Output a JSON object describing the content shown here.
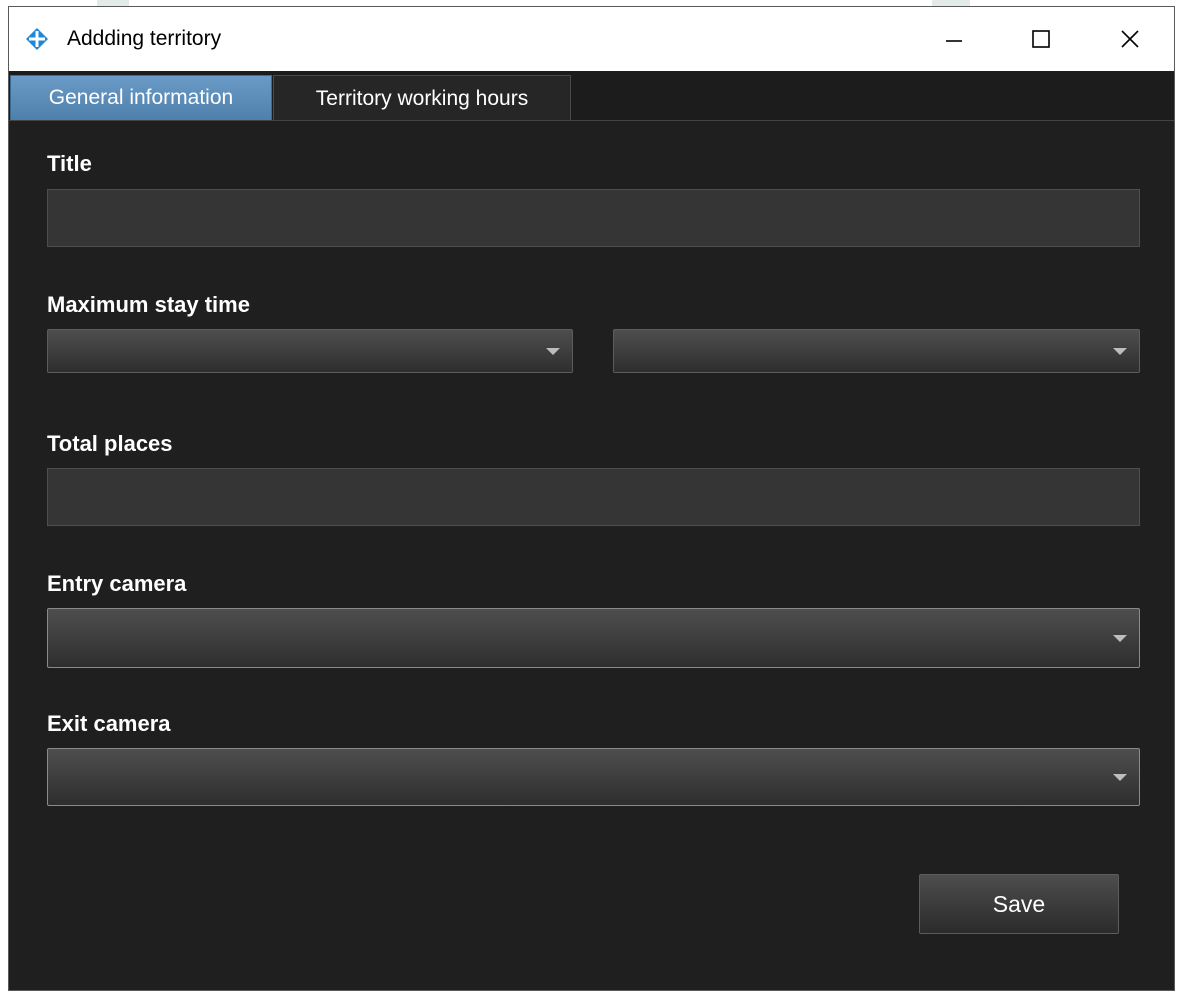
{
  "window": {
    "title": "Addding territory",
    "icons": {
      "app": "diamond-crosshair-icon",
      "minimize": "minimize-icon",
      "maximize": "maximize-icon",
      "close": "close-icon"
    },
    "colors": {
      "accent_tab": "#5b8cb8",
      "background": "#1f1f1f",
      "titlebar": "#ffffff"
    }
  },
  "tabs": [
    {
      "label": "General information",
      "active": true
    },
    {
      "label": "Territory working hours",
      "active": false
    }
  ],
  "form": {
    "title_label": "Title",
    "title_value": "",
    "max_stay_label": "Maximum stay time",
    "max_stay_first_value": "",
    "max_stay_second_value": "",
    "total_places_label": "Total places",
    "total_places_value": "",
    "entry_camera_label": "Entry camera",
    "entry_camera_value": "",
    "exit_camera_label": "Exit camera",
    "exit_camera_value": "",
    "save_label": "Save"
  }
}
